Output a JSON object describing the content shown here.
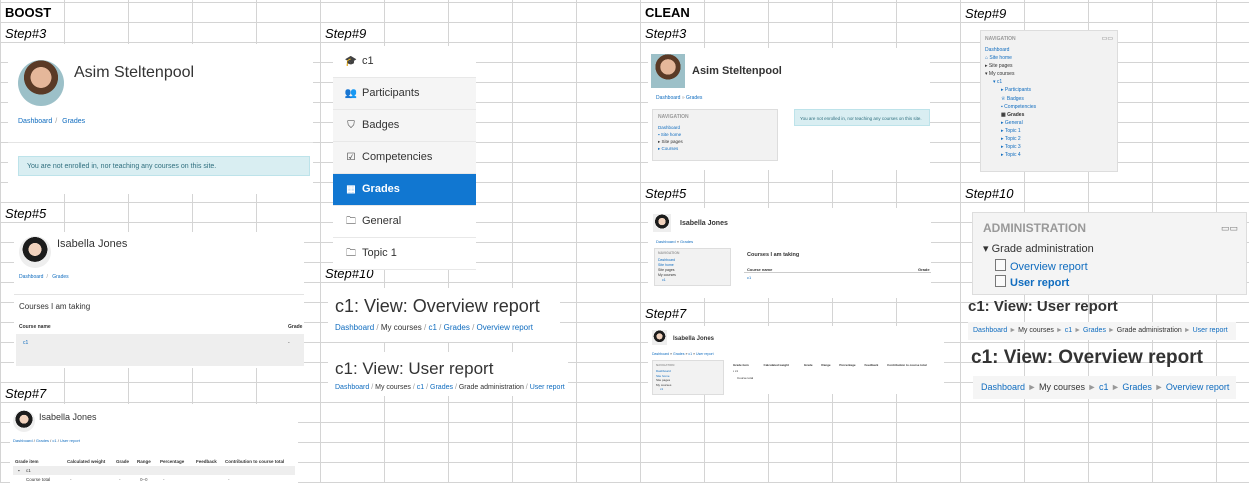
{
  "headers": {
    "boost": "BOOST",
    "clean": "CLEAN"
  },
  "steps": {
    "s3": "Step#3",
    "s5": "Step#5",
    "s7": "Step#7",
    "s9": "Step#9",
    "s10": "Step#10"
  },
  "boost": {
    "s3": {
      "name": "Asim Steltenpool",
      "crumbs": [
        "Dashboard",
        "Grades"
      ],
      "notice": "You are not enrolled in, nor teaching any courses on this site."
    },
    "s5": {
      "name": "Isabella Jones",
      "crumbs": [
        "Dashboard",
        "Grades"
      ],
      "heading": "Courses I am taking",
      "col1": "Course name",
      "col2": "Grade",
      "course": "c1",
      "grade": "-"
    },
    "s7": {
      "name": "Isabella Jones",
      "crumbs": [
        "Dashboard",
        "Grades",
        "c1",
        "User report"
      ],
      "cols": [
        "Grade item",
        "Calculated weight",
        "Grade",
        "Range",
        "Percentage",
        "Feedback",
        "Contribution to course total"
      ],
      "rows": [
        {
          "item": "c1"
        },
        {
          "item": "Course total",
          "vals": [
            "-",
            "-",
            "0–0",
            "-",
            "",
            "-"
          ]
        }
      ]
    },
    "s9": {
      "items": [
        {
          "icon": "graduation-cap-icon",
          "glyph": "🎓",
          "label": "c1"
        },
        {
          "icon": "users-icon",
          "glyph": "👥",
          "label": "Participants"
        },
        {
          "icon": "shield-icon",
          "glyph": "⛉",
          "label": "Badges"
        },
        {
          "icon": "check-square-icon",
          "glyph": "☑",
          "label": "Competencies"
        },
        {
          "icon": "table-icon",
          "glyph": "▦",
          "label": "Grades"
        },
        {
          "icon": "folder-icon",
          "glyph": "🗀",
          "label": "General"
        },
        {
          "icon": "folder-icon",
          "glyph": "🗀",
          "label": "Topic 1"
        }
      ]
    },
    "s10": {
      "overview_title": "c1: View: Overview report",
      "overview_crumbs": [
        "Dashboard",
        "My courses",
        "c1",
        "Grades",
        "Overview report"
      ],
      "user_title": "c1: View: User report",
      "user_crumbs": [
        "Dashboard",
        "My courses",
        "c1",
        "Grades",
        "Grade administration",
        "User report"
      ]
    }
  },
  "clean": {
    "s3": {
      "name": "Asim Steltenpool",
      "crumbs": [
        "Dashboard",
        "Grades"
      ],
      "nav_title": "NAVIGATION",
      "nav_items": [
        "Dashboard",
        "Site home",
        "Site pages",
        "Courses"
      ],
      "notice": "You are not enrolled in, nor teaching any courses on this site."
    },
    "s5": {
      "name": "Isabella Jones",
      "crumbs": [
        "Dashboard",
        "Grades"
      ],
      "nav_title": "NAVIGATION",
      "nav_items": [
        "Dashboard",
        "Site home",
        "Site pages",
        "My courses",
        "c1"
      ],
      "heading": "Courses I am taking",
      "col1": "Course name",
      "col2": "Grade",
      "course": "c1"
    },
    "s7": {
      "name": "Isabella Jones",
      "crumbs": [
        "Dashboard",
        "Grades",
        "c1",
        "User report"
      ],
      "nav_title": "NAVIGATION",
      "nav_items": [
        "Dashboard",
        "Site home",
        "Site pages",
        "My courses",
        "c1"
      ],
      "cols": [
        "Grade item",
        "Calculated weight",
        "Grade",
        "Range",
        "Percentage",
        "Feedback",
        "Contribution to course total"
      ],
      "rows": [
        "c1",
        "Course total"
      ]
    },
    "s9": {
      "title": "NAVIGATION",
      "items": [
        "Dashboard",
        "Site home",
        "Site pages",
        "My courses",
        "c1",
        "Participants",
        "Badges",
        "Competencies",
        "Grades",
        "General",
        "Topic 1",
        "Topic 2",
        "Topic 3",
        "Topic 4"
      ]
    },
    "s10": {
      "admin_title": "ADMINISTRATION",
      "grade_admin": "Grade administration",
      "links": [
        "Overview report",
        "User report"
      ],
      "user_title": "c1: View: User report",
      "user_crumbs": [
        "Dashboard",
        "My courses",
        "c1",
        "Grades",
        "Grade administration",
        "User report"
      ],
      "overview_title": "c1: View: Overview report",
      "overview_crumbs": [
        "Dashboard",
        "My courses",
        "c1",
        "Grades",
        "Overview report"
      ]
    }
  }
}
